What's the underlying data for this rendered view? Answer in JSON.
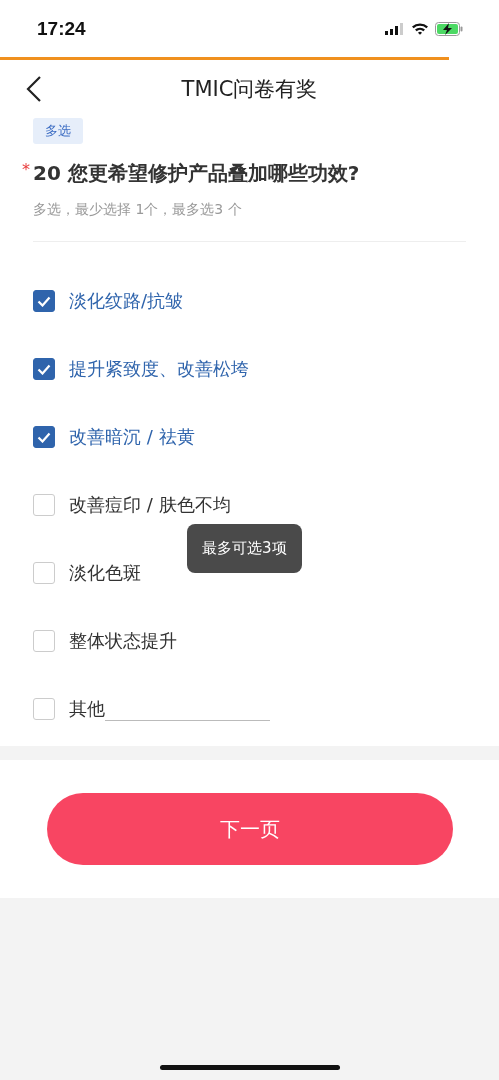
{
  "status_bar": {
    "time": "17:24"
  },
  "loading": {
    "level": 0.9
  },
  "nav": {
    "title": "TMIC问卷有奖"
  },
  "question": {
    "tag": "多选",
    "required_mark": "*",
    "number": "20",
    "title": "您更希望修护产品叠加哪些功效?",
    "hint": "多选，最少选择 1个，最多选3 个"
  },
  "options": [
    {
      "kind": "choice",
      "label": "淡化纹路/抗皱",
      "checked": true
    },
    {
      "kind": "choice",
      "label": "提升紧致度、改善松垮",
      "checked": true
    },
    {
      "kind": "choice",
      "label": "改善暗沉 / 祛黄",
      "checked": true
    },
    {
      "kind": "choice",
      "label": "改善痘印 / 肤色不均",
      "checked": false
    },
    {
      "kind": "choice",
      "label": "淡化色斑",
      "checked": false
    },
    {
      "kind": "choice",
      "label": "整体状态提升",
      "checked": false
    },
    {
      "kind": "other",
      "label": "其他",
      "checked": false
    }
  ],
  "toast": "最多可选3项",
  "next_button": "下一页"
}
